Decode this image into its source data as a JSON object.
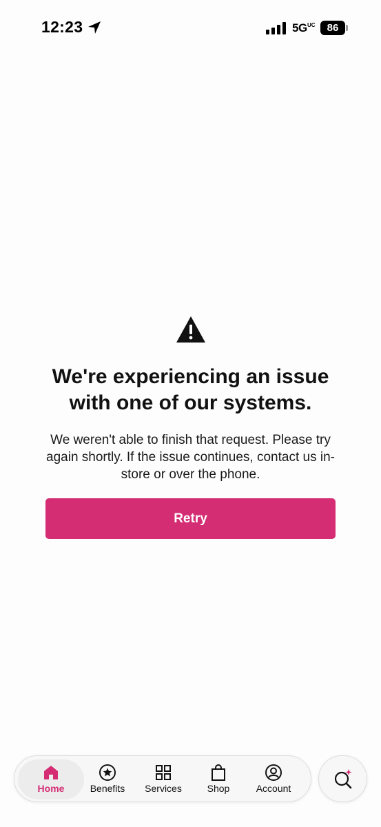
{
  "status_bar": {
    "time": "12:23",
    "network": "5G",
    "network_suffix": "UC",
    "battery": "86",
    "icons": [
      "location-arrow-icon",
      "signal-bars-icon",
      "battery-icon"
    ]
  },
  "error": {
    "icon": "warning-triangle-icon",
    "headline": "We're experiencing an issue with one of our systems.",
    "message": "We weren't able to finish that request. Please try again shortly. If the issue continues, contact us in-store or over the phone.",
    "retry_label": "Retry"
  },
  "bottom_nav": {
    "items": [
      {
        "label": "Home",
        "icon": "home-icon",
        "active": true
      },
      {
        "label": "Benefits",
        "icon": "star-circle-icon",
        "active": false
      },
      {
        "label": "Services",
        "icon": "grid-icon",
        "active": false
      },
      {
        "label": "Shop",
        "icon": "shopping-bag-icon",
        "active": false
      },
      {
        "label": "Account",
        "icon": "account-icon",
        "active": false
      }
    ],
    "search_icon": "search-sparkle-icon"
  },
  "colors": {
    "accent": "#d42d74",
    "background": "#fdfdfd",
    "text": "#111111"
  }
}
